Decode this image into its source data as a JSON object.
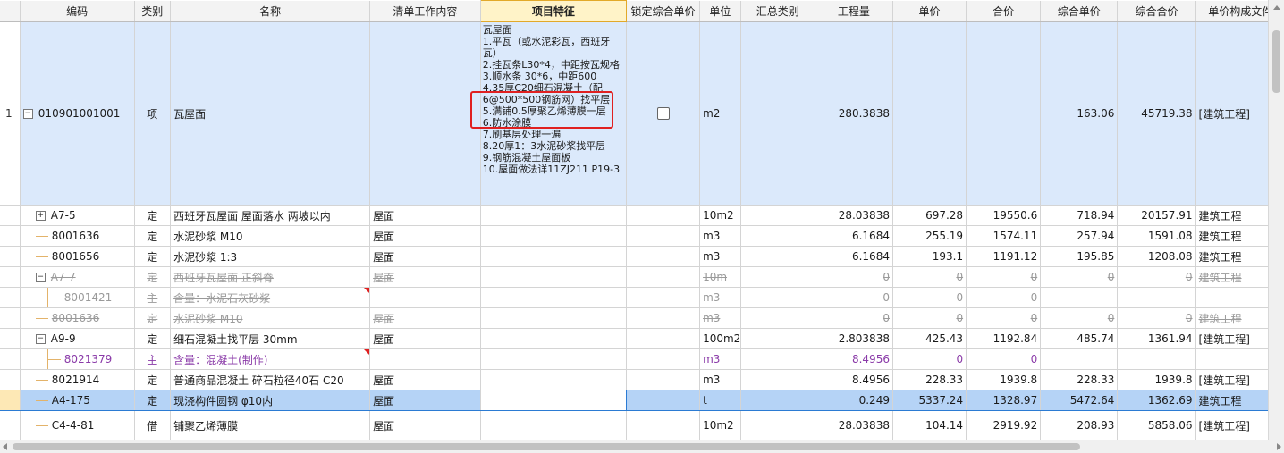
{
  "headers": [
    "",
    "编码",
    "类别",
    "名称",
    "清单工作内容",
    "项目特征",
    "锁定综合单价",
    "单位",
    "汇总类别",
    "工程量",
    "单价",
    "合价",
    "综合单价",
    "综合合价",
    "单价构成文件"
  ],
  "main_row": {
    "row_no": "1",
    "code": "010901001001",
    "type": "项",
    "name": "瓦屋面",
    "unit": "m2",
    "qty": "280.3838",
    "comp_price": "163.06",
    "comp_total": "45719.38",
    "file": "[建筑工程]",
    "features": [
      "瓦屋面",
      "1.平瓦（或水泥彩瓦，西班牙瓦）",
      "2.挂瓦条L30*4，中距按瓦规格",
      "3.顺水条 30*6，中距600",
      "4.35厚C20细石混凝土（配6@500*500钢筋网）找平层",
      "5.满铺0.5厚聚乙烯薄膜一层",
      "6.防水涂膜",
      "7.刷基层处理一遍",
      "8.20厚1：3水泥砂浆找平层",
      "9.钢筋混凝土屋面板",
      "10.屋面做法详11ZJ211 P19-3"
    ]
  },
  "rows": [
    {
      "code": "A7-5",
      "type": "定",
      "name": "西班牙瓦屋面 屋面落水 两坡以内",
      "work": "屋面",
      "unit": "10m2",
      "qty": "28.03838",
      "price": "697.28",
      "total": "19550.6",
      "comp_price": "718.94",
      "comp_total": "20157.91",
      "file": "建筑工程"
    },
    {
      "code": "8001636",
      "type": "定",
      "name": "水泥砂浆 M10",
      "work": "屋面",
      "unit": "m3",
      "qty": "6.1684",
      "price": "255.19",
      "total": "1574.11",
      "comp_price": "257.94",
      "comp_total": "1591.08",
      "file": "建筑工程"
    },
    {
      "code": "8001656",
      "type": "定",
      "name": "水泥砂浆 1:3",
      "work": "屋面",
      "unit": "m3",
      "qty": "6.1684",
      "price": "193.1",
      "total": "1191.12",
      "comp_price": "195.85",
      "comp_total": "1208.08",
      "file": "建筑工程"
    },
    {
      "code": "A7-7",
      "type": "定",
      "name": "西班牙瓦屋面 正斜脊",
      "work": "屋面",
      "unit": "10m",
      "qty": "0",
      "price": "0",
      "total": "0",
      "comp_price": "0",
      "comp_total": "0",
      "file": "建筑工程"
    },
    {
      "code": "8001421",
      "type": "主",
      "name": "含量：水泥石灰砂浆",
      "work": "",
      "unit": "m3",
      "qty": "0",
      "price": "0",
      "total": "0",
      "comp_price": "",
      "comp_total": "",
      "file": ""
    },
    {
      "code": "8001636",
      "type": "定",
      "name": "水泥砂浆 M10",
      "work": "屋面",
      "unit": "m3",
      "qty": "0",
      "price": "0",
      "total": "0",
      "comp_price": "0",
      "comp_total": "0",
      "file": "建筑工程"
    },
    {
      "code": "A9-9",
      "type": "定",
      "name": "细石混凝土找平层 30mm",
      "work": "屋面",
      "unit": "100m2",
      "qty": "2.803838",
      "price": "425.43",
      "total": "1192.84",
      "comp_price": "485.74",
      "comp_total": "1361.94",
      "file": "[建筑工程]"
    },
    {
      "code": "8021379",
      "type": "主",
      "name": "含量：混凝土(制作)",
      "work": "",
      "unit": "m3",
      "qty": "8.4956",
      "price": "0",
      "total": "0",
      "comp_price": "",
      "comp_total": "",
      "file": ""
    },
    {
      "code": "8021914",
      "type": "定",
      "name": "普通商品混凝土 碎石粒径40石 C20",
      "work": "屋面",
      "unit": "m3",
      "qty": "8.4956",
      "price": "228.33",
      "total": "1939.8",
      "comp_price": "228.33",
      "comp_total": "1939.8",
      "file": "[建筑工程]"
    },
    {
      "code": "A4-175",
      "type": "定",
      "name": "现浇构件圆钢 φ10内",
      "work": "屋面",
      "unit": "t",
      "qty": "0.249",
      "price": "5337.24",
      "total": "1328.97",
      "comp_price": "5472.64",
      "comp_total": "1362.69",
      "file": "建筑工程"
    },
    {
      "code": "C4-4-81",
      "type": "借",
      "name": "铺聚乙烯薄膜",
      "work": "屋面",
      "unit": "10m2",
      "qty": "28.03838",
      "price": "104.14",
      "total": "2919.92",
      "comp_price": "208.93",
      "comp_total": "5858.06",
      "file": "[建筑工程]"
    }
  ]
}
